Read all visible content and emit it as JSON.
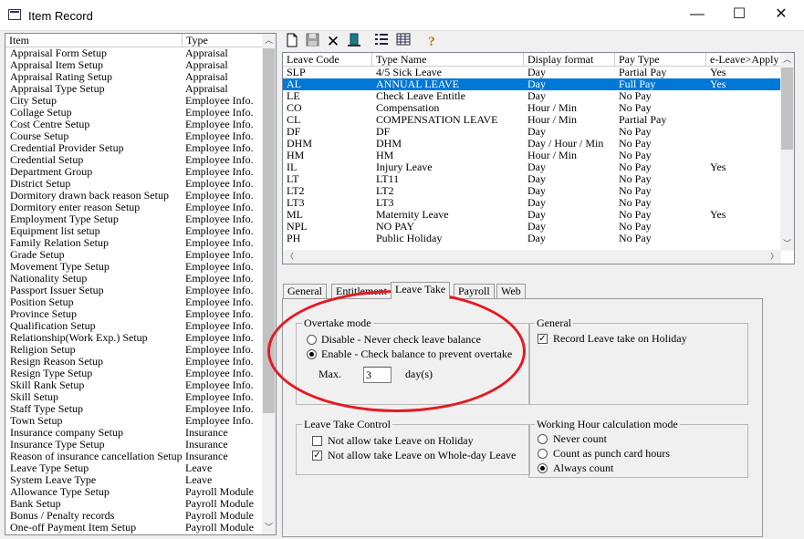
{
  "window": {
    "title": "Item Record",
    "minimize": "—",
    "maximize": "☐",
    "close": "✕"
  },
  "item_list": {
    "headers": [
      "Item",
      "Type"
    ],
    "rows": [
      [
        "Appraisal Form Setup",
        "Appraisal"
      ],
      [
        "Appraisal Item Setup",
        "Appraisal"
      ],
      [
        "Appraisal Rating Setup",
        "Appraisal"
      ],
      [
        "Appraisal Type Setup",
        "Appraisal"
      ],
      [
        "City Setup",
        "Employee Info."
      ],
      [
        "Collage Setup",
        "Employee Info."
      ],
      [
        "Cost Centre Setup",
        "Employee Info."
      ],
      [
        "Course Setup",
        "Employee Info."
      ],
      [
        "Credential Provider Setup",
        "Employee Info."
      ],
      [
        "Credential Setup",
        "Employee Info."
      ],
      [
        "Department Group",
        "Employee Info."
      ],
      [
        "District Setup",
        "Employee Info."
      ],
      [
        "Dormitory drawn back reason Setup",
        "Employee Info."
      ],
      [
        "Dormitory enter reason Setup",
        "Employee Info."
      ],
      [
        "Employment Type Setup",
        "Employee Info."
      ],
      [
        "Equipment list setup",
        "Employee Info."
      ],
      [
        "Family Relation Setup",
        "Employee Info."
      ],
      [
        "Grade Setup",
        "Employee Info."
      ],
      [
        "Movement Type Setup",
        "Employee Info."
      ],
      [
        "Nationality Setup",
        "Employee Info."
      ],
      [
        "Passport Issuer Setup",
        "Employee Info."
      ],
      [
        "Position Setup",
        "Employee Info."
      ],
      [
        "Province Setup",
        "Employee Info."
      ],
      [
        "Qualification Setup",
        "Employee Info."
      ],
      [
        "Relationship(Work Exp.) Setup",
        "Employee Info."
      ],
      [
        "Religion Setup",
        "Employee Info."
      ],
      [
        "Resign Reason Setup",
        "Employee Info."
      ],
      [
        "Resign Type Setup",
        "Employee Info."
      ],
      [
        "Skill Rank Setup",
        "Employee Info."
      ],
      [
        "Skill Setup",
        "Employee Info."
      ],
      [
        "Staff Type Setup",
        "Employee Info."
      ],
      [
        "Town Setup",
        "Employee Info."
      ],
      [
        "Insurance company Setup",
        "Insurance"
      ],
      [
        "Insurance Type Setup",
        "Insurance"
      ],
      [
        "Reason of insurance cancellation Setup",
        "Insurance"
      ],
      [
        "Leave Type Setup",
        "Leave"
      ],
      [
        "System Leave Type",
        "Leave"
      ],
      [
        "Allowance Type Setup",
        "Payroll Module"
      ],
      [
        "Bank Setup",
        "Payroll Module"
      ],
      [
        "Bonus / Penalty records",
        "Payroll Module"
      ],
      [
        "One-off Payment Item Setup",
        "Payroll Module"
      ]
    ]
  },
  "toolbar": {
    "new_icon": "new-document-icon",
    "save_icon": "save-icon",
    "delete_icon": "delete-x-icon",
    "exit_icon": "exit-door-icon",
    "list_icon": "list-view-icon",
    "grid_icon": "grid-view-icon",
    "help_icon": "help-icon"
  },
  "leave_grid": {
    "headers": [
      "Leave Code",
      "Type Name",
      "Display format",
      "Pay Type",
      "e-Leave>Apply"
    ],
    "selected_index": 1,
    "rows": [
      [
        "SLP",
        "4/5 Sick Leave",
        "Day",
        "Partial Pay",
        "Yes"
      ],
      [
        "AL",
        "ANNUAL LEAVE",
        "Day",
        "Full Pay",
        "Yes"
      ],
      [
        "LE",
        "Check Leave Entitle",
        "Day",
        "No Pay",
        ""
      ],
      [
        "CO",
        "Compensation",
        "Hour / Min",
        "No Pay",
        ""
      ],
      [
        "CL",
        "COMPENSATION LEAVE",
        "Hour / Min",
        "Partial Pay",
        ""
      ],
      [
        "DF",
        "DF",
        "Day",
        "No Pay",
        ""
      ],
      [
        "DHM",
        "DHM",
        "Day / Hour / Min",
        "No Pay",
        ""
      ],
      [
        "HM",
        "HM",
        "Hour / Min",
        "No Pay",
        ""
      ],
      [
        "IL",
        "Injury Leave",
        "Day",
        "No Pay",
        "Yes"
      ],
      [
        "LT",
        "LT11",
        "Day",
        "No Pay",
        ""
      ],
      [
        "LT2",
        "LT2",
        "Day",
        "No Pay",
        ""
      ],
      [
        "LT3",
        "LT3",
        "Day",
        "No Pay",
        ""
      ],
      [
        "ML",
        "Maternity Leave",
        "Day",
        "No Pay",
        "Yes"
      ],
      [
        "NPL",
        "NO PAY",
        "Day",
        "No Pay",
        ""
      ],
      [
        "PH",
        "Public Holiday",
        "Day",
        "No Pay",
        ""
      ]
    ]
  },
  "tabs": [
    "General",
    "Entitlement",
    "Leave Take",
    "Payroll",
    "Web"
  ],
  "active_tab": "Leave Take",
  "overtake": {
    "title": "Overtake mode",
    "disable_label": "Disable - Never check leave balance",
    "enable_label": "Enable - Check balance to prevent overtake",
    "selected": "enable",
    "max_label": "Max.",
    "max_value": "3",
    "unit": "day(s)"
  },
  "general_group": {
    "title": "General",
    "record_holiday_label": "Record Leave take on Holiday",
    "record_holiday_checked": true
  },
  "leave_take_control": {
    "title": "Leave Take Control",
    "not_allow_holiday_label": "Not allow take Leave on Holiday",
    "not_allow_holiday_checked": false,
    "not_allow_wholeday_label": "Not allow take Leave on Whole-day Leave",
    "not_allow_wholeday_checked": true
  },
  "working_hour": {
    "title": "Working Hour calculation mode",
    "options": [
      "Never count",
      "Count as punch card hours",
      "Always count"
    ],
    "selected_index": 2
  },
  "colors": {
    "selection": "#0078d7",
    "annotation": "#e31b23"
  }
}
